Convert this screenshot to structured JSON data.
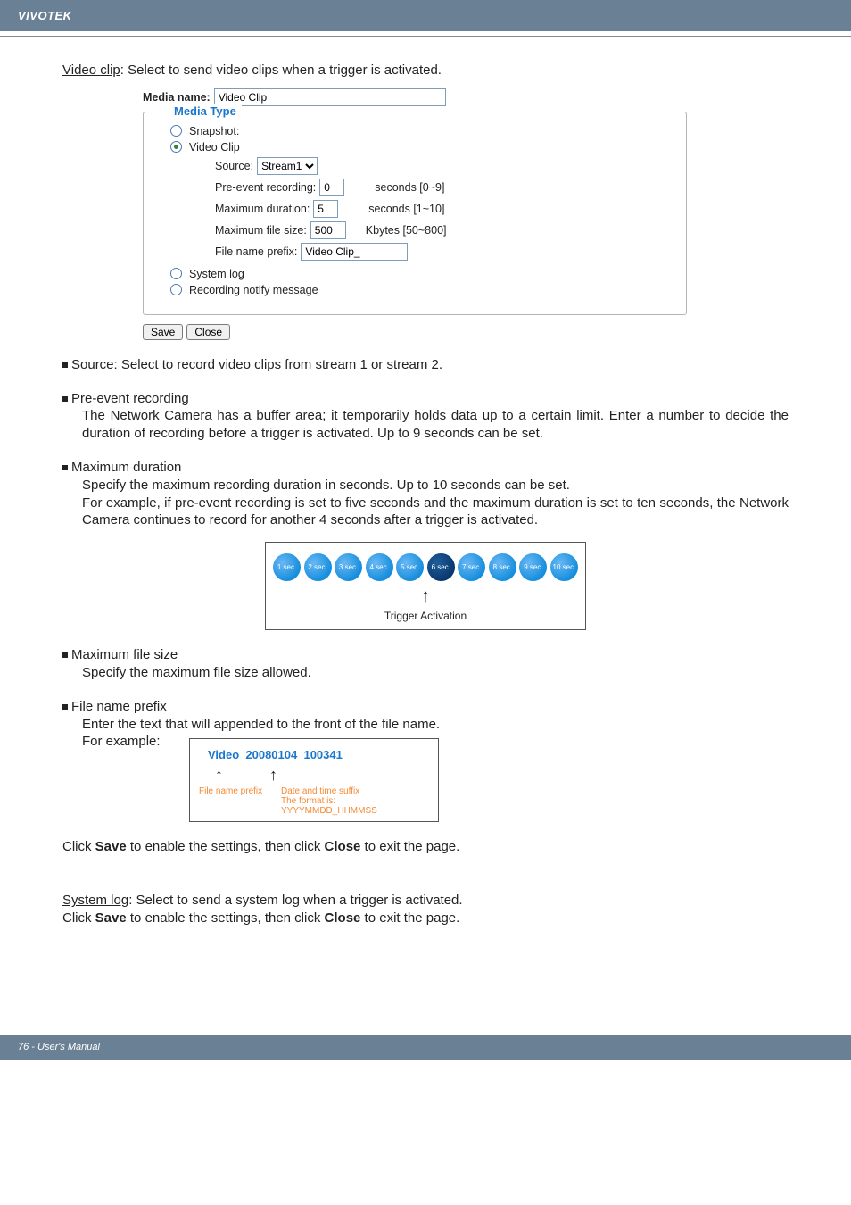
{
  "header": {
    "brand": "VIVOTEK"
  },
  "intro": {
    "term": "Video clip",
    "desc": ": Select to send video clips when a trigger is activated."
  },
  "form": {
    "media_name_label": "Media name:",
    "media_name_value": "Video Clip",
    "legend": "Media Type",
    "snapshot_label": "Snapshot:",
    "videoclip_label": "Video Clip",
    "source_label": "Source:",
    "source_value": "Stream1",
    "pre_event_label": "Pre-event recording:",
    "pre_event_value": "0",
    "pre_event_units": "seconds [0~9]",
    "max_dur_label": "Maximum duration:",
    "max_dur_value": "5",
    "max_dur_units": "seconds [1~10]",
    "max_size_label": "Maximum file size:",
    "max_size_value": "500",
    "max_size_units": "Kbytes [50~800]",
    "prefix_label": "File name prefix:",
    "prefix_value": "Video Clip_",
    "syslog_label": "System log",
    "recnotify_label": "Recording notify message",
    "save_btn": "Save",
    "close_btn": "Close"
  },
  "bullets": {
    "source": "Source: Select to record video clips from stream 1 or stream 2.",
    "pre_h": "Pre-event recording",
    "pre_b": "The Network Camera has a buffer area; it temporarily holds data up to a certain limit. Enter a number to decide the duration of recording before a trigger is activated. Up to 9 seconds can be set.",
    "maxdur_h": "Maximum duration",
    "maxdur_b1": "Specify the maximum recording duration in seconds. Up to 10 seconds can be set.",
    "maxdur_b2": "For example, if pre-event recording is set to five seconds and the maximum duration is set to ten seconds, the Network Camera continues to record for another 4 seconds after a trigger is activated.",
    "maxsize_h": "Maximum file size",
    "maxsize_b": "Specify the maximum file size allowed.",
    "prefix_h": "File name prefix",
    "prefix_b1": "Enter the text that will appended to the front of the file name.",
    "prefix_b2": " For example:"
  },
  "diagram1": {
    "bubbles": [
      "1 sec.",
      "2 sec.",
      "3 sec.",
      "4 sec.",
      "5 sec.",
      "6 sec.",
      "7 sec.",
      "8 sec.",
      "9 sec.",
      "10 sec."
    ],
    "dark_index": 5,
    "label": "Trigger Activation"
  },
  "diagram2": {
    "title": "Video_20080104_100341",
    "l1": "File name prefix",
    "l2": "Date and time suffix",
    "l3": "The format is: YYYYMMDD_HHMMSS"
  },
  "tail": {
    "line1a": "Click ",
    "line1b": "Save",
    "line1c": " to enable the settings, then click ",
    "line1d": "Close",
    "line1e": " to exit the page.",
    "syslog_term": "System log",
    "syslog_desc": ": Select to send a system log when a trigger is activated."
  },
  "footer": {
    "pageno": "76 - User's Manual"
  }
}
